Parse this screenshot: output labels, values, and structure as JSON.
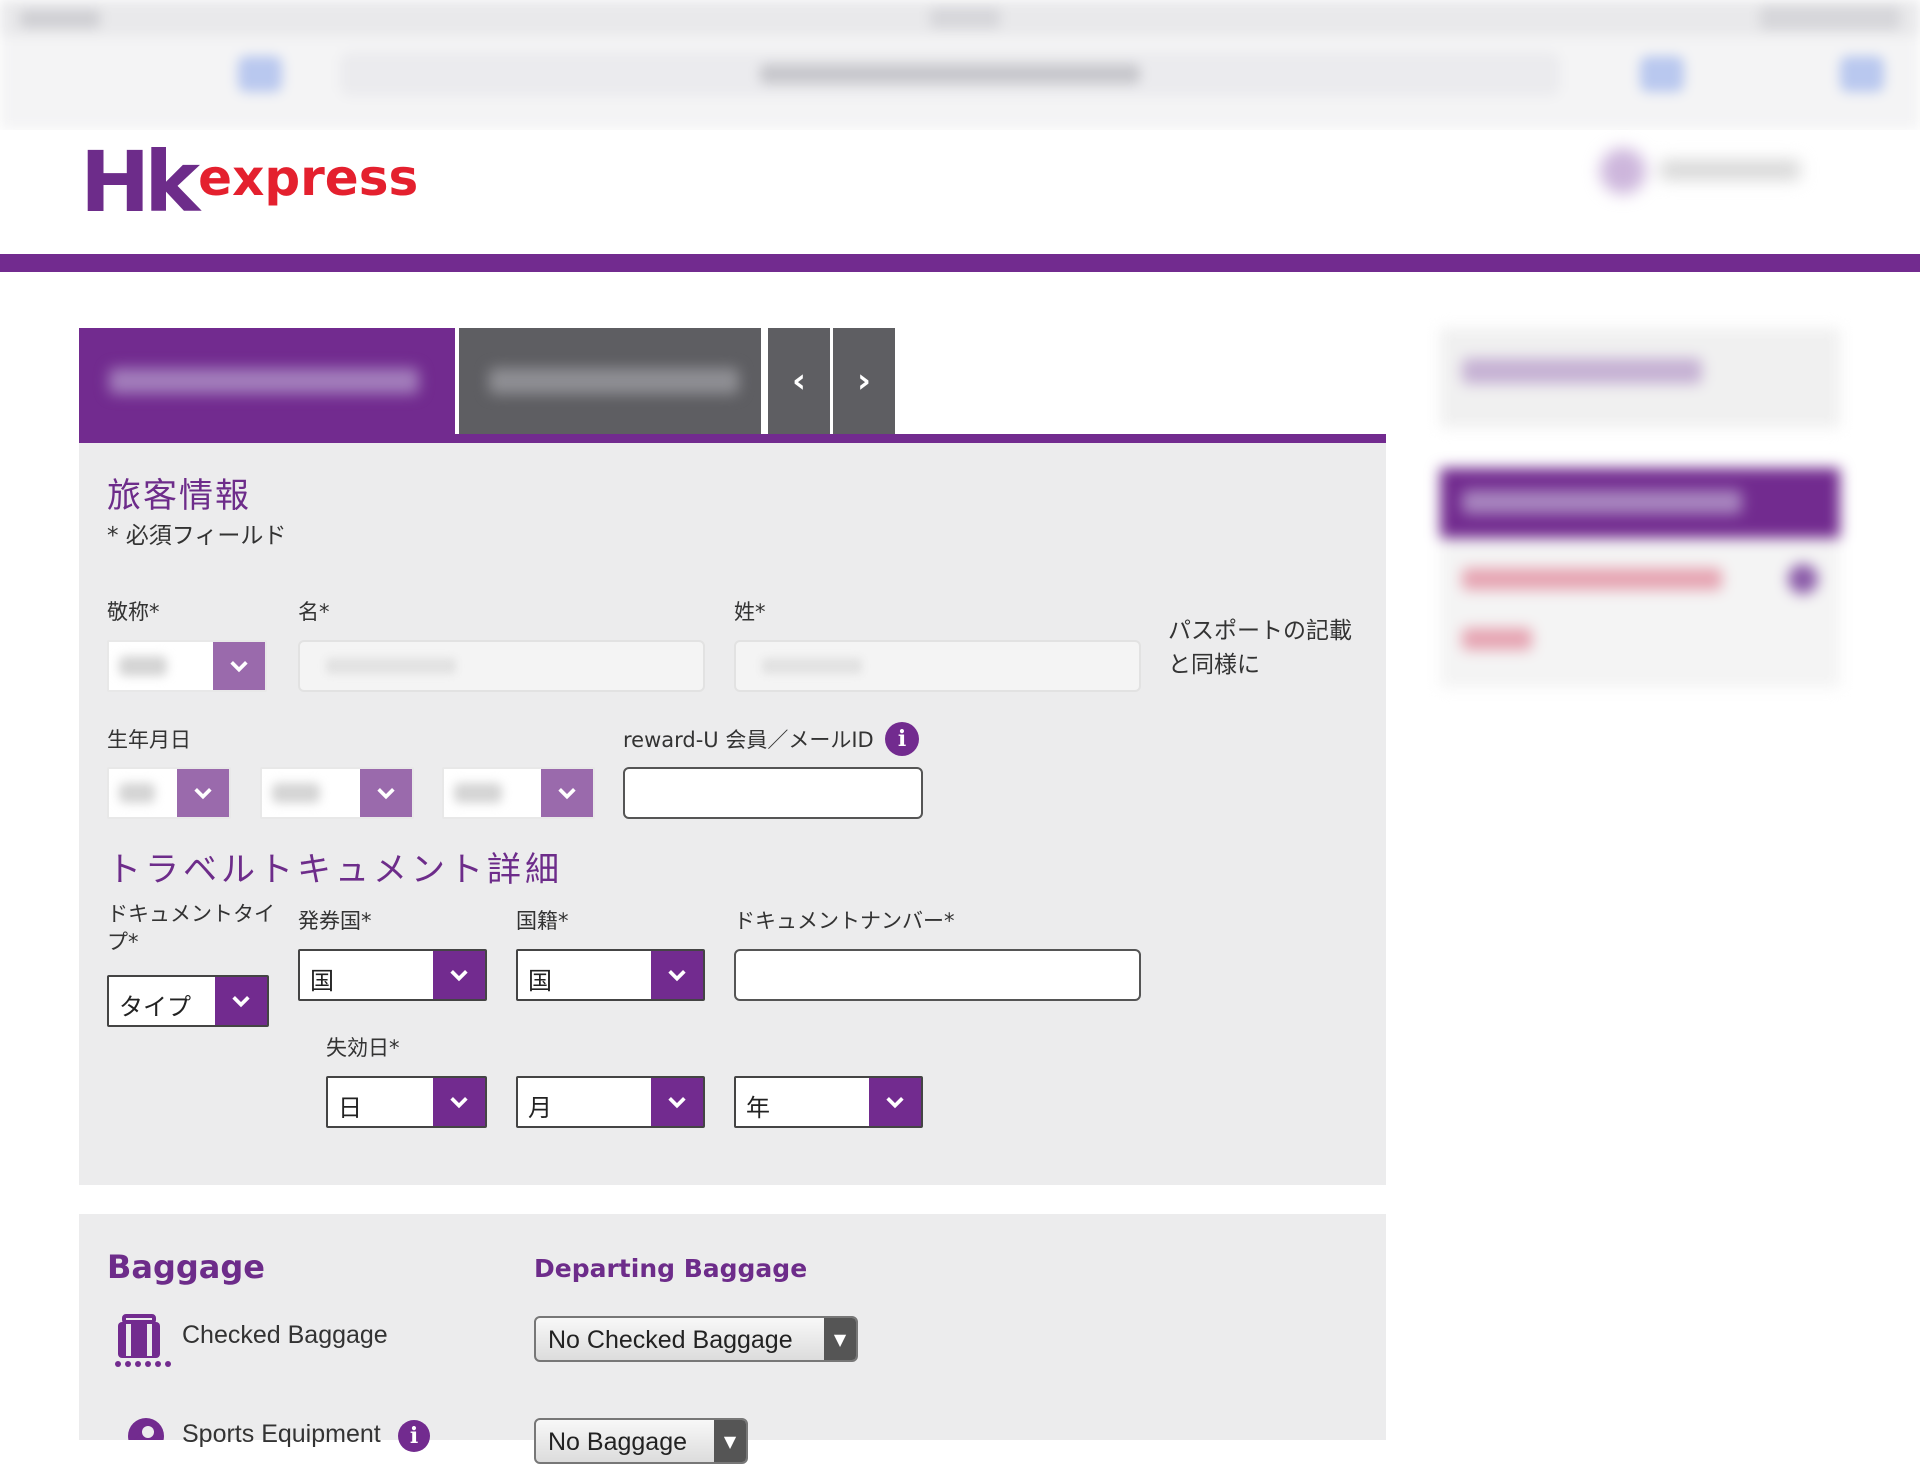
{
  "logo": {
    "hk": "Hk",
    "express": "express"
  },
  "passenger": {
    "title": "旅客情報",
    "required_note": "* 必須フィールド",
    "title_label": "敬称*",
    "first_name_label": "名*",
    "last_name_label": "姓*",
    "passport_note": "パスポートの記載と同様に",
    "dob_label": "生年月日",
    "reward_label": "reward-U 会員／メールID",
    "reward_value": ""
  },
  "travel_doc": {
    "title": "トラベルトキュメント詳細",
    "doc_type_label": "ドキュメントタイプ*",
    "doc_type_value": "タイプ",
    "issuing_label": "発券国*",
    "issuing_value": "国",
    "nationality_label": "国籍*",
    "nationality_value": "国",
    "doc_number_label": "ドキュメントナンバー*",
    "doc_number_value": "",
    "expiry_label": "失効日*",
    "expiry_day": "日",
    "expiry_month": "月",
    "expiry_year": "年"
  },
  "baggage": {
    "title": "Baggage",
    "departing_title": "Departing Baggage",
    "checked_label": "Checked Baggage",
    "checked_value": "No Checked Baggage",
    "sports_label": "Sports Equipment",
    "sports_value": "No Baggage"
  },
  "icons": {
    "chevron": "chevron-down-icon",
    "prev": "‹",
    "next": "›",
    "info": "i",
    "dd_arrow": "▼"
  },
  "colors": {
    "brand_purple": "#722b8f",
    "brand_red": "#e4202e"
  }
}
